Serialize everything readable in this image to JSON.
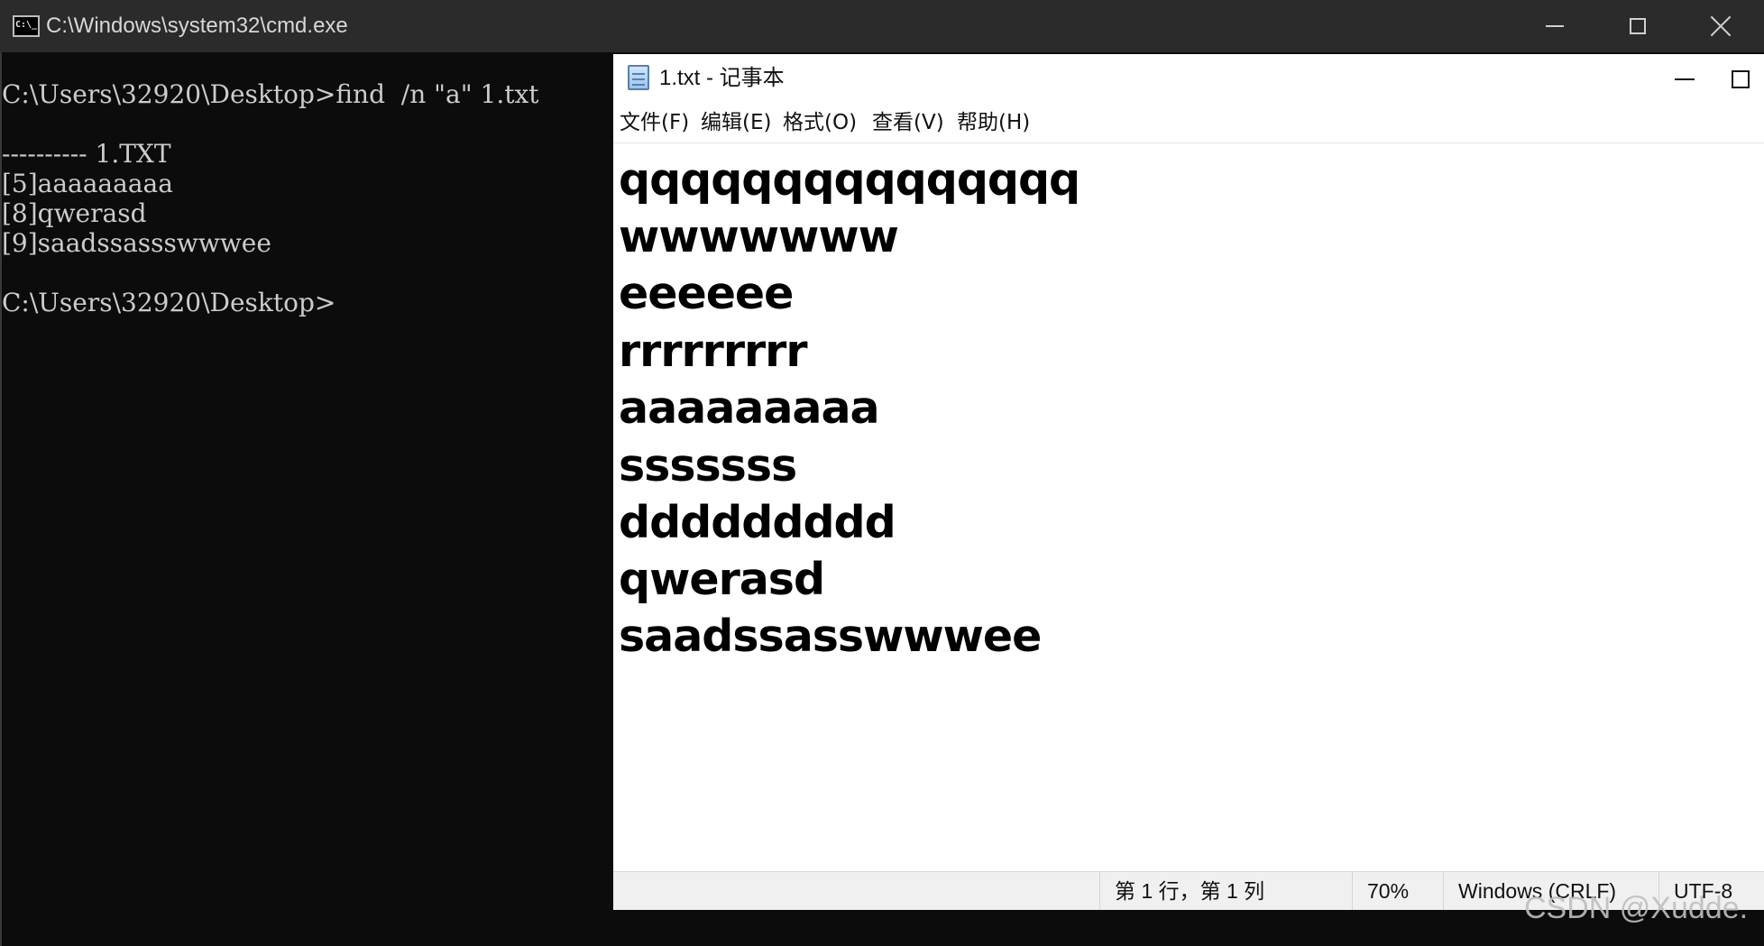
{
  "cmd": {
    "title": "C:\\Windows\\system32\\cmd.exe",
    "icon": "C:\\_",
    "lines": [
      "C:\\Users\\32920\\Desktop>find  /n \"a\" 1.txt",
      "---------- 1.TXT",
      "[5]aaaaaaaaa",
      "[8]qwerasd",
      "[9]saadssassswwwee",
      "C:\\Users\\32920\\Desktop>"
    ]
  },
  "notepad": {
    "title": "1.txt - 记事本",
    "menu": [
      "文件(F)",
      "编辑(E)",
      "格式(O)",
      "查看(V)",
      "帮助(H)"
    ],
    "content_lines": [
      "qqqqqqqqqqqqqqq",
      "wwwwwww",
      "eeeeee",
      "rrrrrrrrr",
      "aaaaaaaaa",
      "sssssss",
      "ddddddddd",
      "qwerasd",
      "saadssasswwwee"
    ],
    "status": {
      "position": "第 1 行，第 1 列",
      "zoom": "70%",
      "line_ending": "Windows (CRLF)",
      "encoding": "UTF-8"
    }
  },
  "watermark": "CSDN @Xudde."
}
